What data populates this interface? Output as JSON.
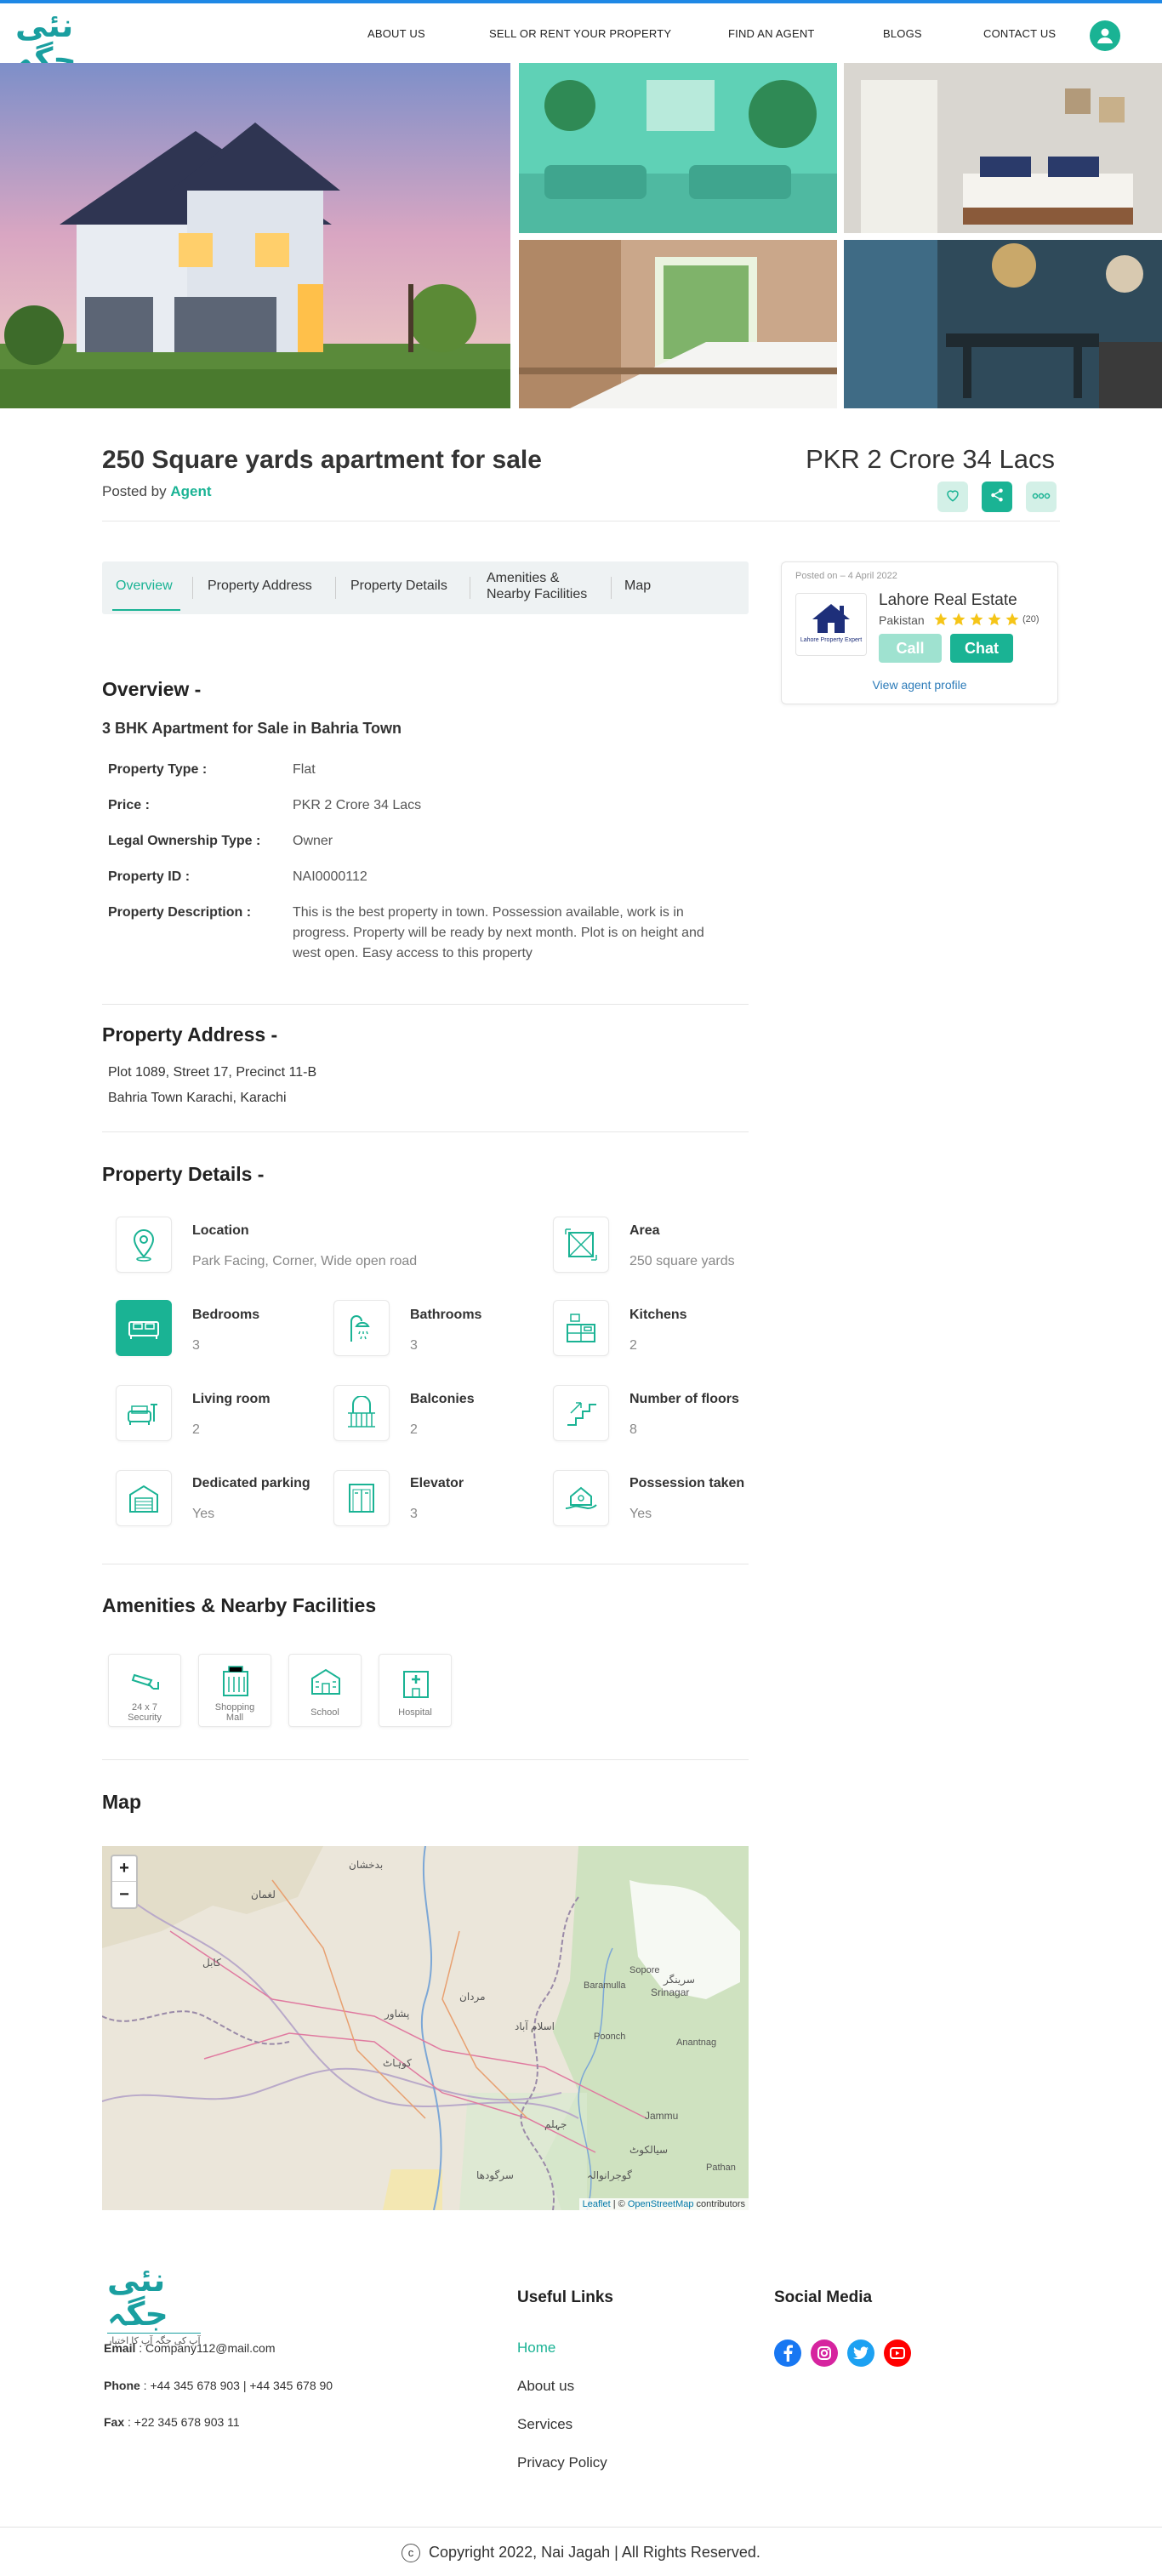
{
  "brand": {
    "logo_main": "نئی جگہ",
    "logo_sub": "آپ کی جگہ آپ کا اختیار"
  },
  "nav": {
    "items": [
      "ABOUT US",
      "SELL OR RENT YOUR PROPERTY",
      "FIND AN AGENT",
      "BLOGS",
      "CONTACT US"
    ]
  },
  "listing": {
    "title": "250 Square yards apartment for sale",
    "posted_by_prefix": "Posted by",
    "posted_by": "Agent",
    "price": "PKR  2 Crore 34 Lacs"
  },
  "tabs": [
    "Overview",
    "Property Address",
    "Property Details",
    "Amenities &\nNearby Facilities",
    "Map"
  ],
  "agent": {
    "posted_on": "Posted on – 4 April 2022",
    "name": "Lahore Real Estate",
    "country": "Pakistan",
    "rating": 5,
    "reviews": "(20)",
    "call_label": "Call",
    "chat_label": "Chat",
    "profile_link": "View agent profile",
    "logo_caption": "Lahore Property Expert"
  },
  "overview": {
    "heading": "Overview -",
    "subheading": "3 BHK Apartment for Sale in Bahria Town",
    "rows": [
      {
        "k": "Property Type :",
        "v": "Flat"
      },
      {
        "k": "Price :",
        "v": "PKR 2 Crore 34 Lacs"
      },
      {
        "k": "Legal Ownership Type :",
        "v": "Owner"
      },
      {
        "k": "Property ID :",
        "v": "NAI0000112"
      },
      {
        "k": "Property Description :",
        "v": "This is the best property in town. Possession available, work is in progress. Property will be ready by next month. Plot is on height and west open. Easy access to this property"
      }
    ]
  },
  "address": {
    "heading": "Property Address -",
    "line1": "Plot 1089, Street 17, Precinct 11-B",
    "line2": "Bahria Town Karachi, Karachi"
  },
  "details": {
    "heading": "Property Details -",
    "items": [
      {
        "label": "Location",
        "value": "Park Facing, Corner, Wide open road"
      },
      {
        "label": "Area",
        "value": "250 square yards"
      },
      {
        "label": "Bedrooms",
        "value": "3"
      },
      {
        "label": "Bathrooms",
        "value": "3"
      },
      {
        "label": "Kitchens",
        "value": "2"
      },
      {
        "label": "Living room",
        "value": "2"
      },
      {
        "label": "Balconies",
        "value": "2"
      },
      {
        "label": "Number of floors",
        "value": "8"
      },
      {
        "label": "Dedicated parking",
        "value": "Yes"
      },
      {
        "label": "Elevator",
        "value": "3"
      },
      {
        "label": "Possession taken",
        "value": "Yes"
      }
    ]
  },
  "amenities": {
    "heading": "Amenities & Nearby Facilities",
    "items": [
      "24 x 7\nSecurity",
      "Shopping\nMall",
      "School",
      "Hospital"
    ]
  },
  "map": {
    "heading": "Map",
    "zoom_in": "+",
    "zoom_out": "−",
    "attr_leaflet": "Leaflet",
    "attr_sep": " | © ",
    "attr_osm": "OpenStreetMap",
    "attr_tail": " contributors",
    "labels": [
      "کابل",
      "پشاور",
      "اسلام آباد",
      "سرینگر",
      "Srinagar",
      "Jammu",
      "Anantnag",
      "Baramulla",
      "Sopore",
      "Poonch",
      "Pathan",
      "سیالکوٹ",
      "گوجرانوالہ",
      "سرگودھا",
      "جہلم",
      "کوہاٹ",
      "مردان",
      "لغمان",
      "بدخشان"
    ]
  },
  "footer": {
    "email_label": "Email",
    "email": " : Company112@mail.com",
    "phone_label": "Phone",
    "phone": " : +44 345 678 903  | +44 345 678 90",
    "fax_label": "Fax",
    "fax": " : +22 345 678 903 11",
    "useful_heading": "Useful Links",
    "links": [
      "Home",
      "About us",
      "Services",
      "Privacy Policy"
    ],
    "social_heading": "Social Media",
    "copyright": "Copyright  2022, Nai Jagah |  All Rights Reserved."
  },
  "colors": {
    "accent": "#1ab394",
    "topbar": "#1e88e5",
    "star": "#f5c518"
  }
}
